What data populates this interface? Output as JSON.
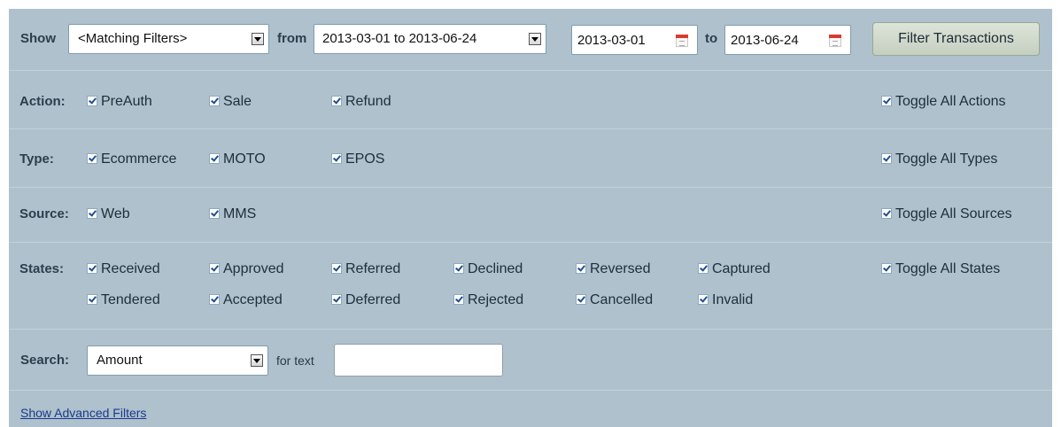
{
  "header": {
    "show_label": "Show",
    "show_select_value": "<Matching Filters>",
    "from_label": "from",
    "range_select_value": "2013-03-01 to 2013-06-24",
    "start_date": "2013-03-01",
    "to_label": "to",
    "end_date": "2013-06-24",
    "filter_button": "Filter Transactions"
  },
  "action": {
    "label": "Action:",
    "options": [
      "PreAuth",
      "Sale",
      "Refund"
    ],
    "toggle": "Toggle All Actions"
  },
  "type": {
    "label": "Type:",
    "options": [
      "Ecommerce",
      "MOTO",
      "EPOS"
    ],
    "toggle": "Toggle All Types"
  },
  "source": {
    "label": "Source:",
    "options": [
      "Web",
      "MMS"
    ],
    "toggle": "Toggle All Sources"
  },
  "states": {
    "label": "States:",
    "row1": [
      "Received",
      "Approved",
      "Referred",
      "Declined",
      "Reversed",
      "Captured"
    ],
    "row2": [
      "Tendered",
      "Accepted",
      "Deferred",
      "Rejected",
      "Cancelled",
      "Invalid"
    ],
    "toggle": "Toggle All States"
  },
  "search": {
    "label": "Search:",
    "field_value": "Amount",
    "for_text_label": "for text",
    "text_value": ""
  },
  "advanced_link": "Show Advanced Filters",
  "colors": {
    "panel_bg": "#aec1cd",
    "link": "#1a3a8a",
    "button_bg": "#d3dccf"
  }
}
